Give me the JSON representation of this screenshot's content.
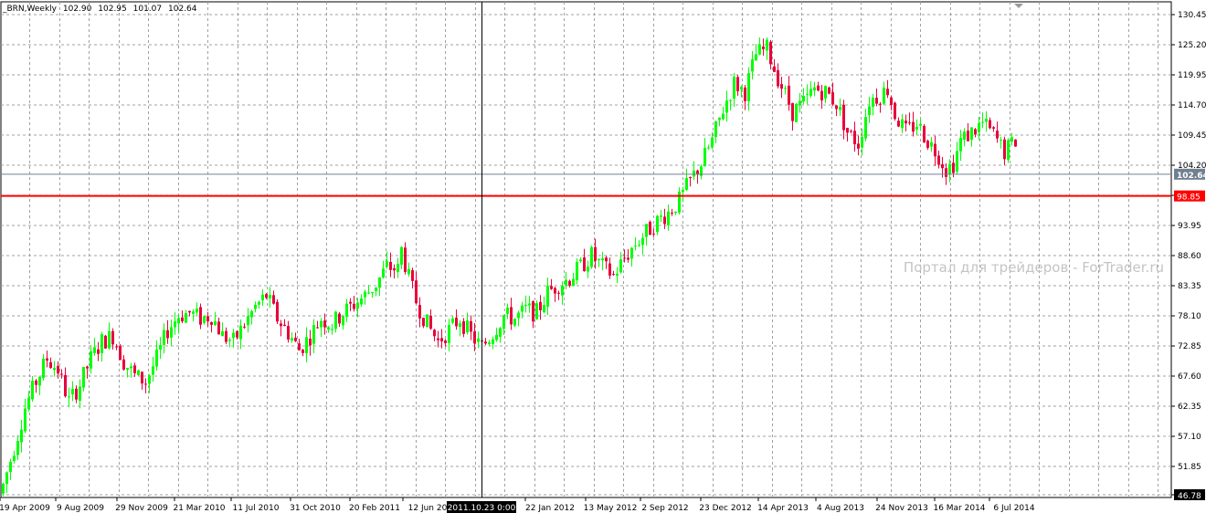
{
  "header": {
    "symbol": "_BRN,Weekly",
    "open": "102.90",
    "high": "102.95",
    "low": "101.07",
    "close": "102.64"
  },
  "watermark": "Портал для трейдеров - ForTrader.ru",
  "colors": {
    "bull": "#00ff00",
    "bear": "#e8003a",
    "grid": "#a0a0a0",
    "level_line": "#ff0000",
    "current_line": "#708090"
  },
  "chart_data": {
    "type": "candlestick",
    "timeframe": "Weekly",
    "symbol": "_BRN",
    "y_ticks": [
      "130.45",
      "125.20",
      "119.95",
      "114.70",
      "109.45",
      "104.20",
      "98.95",
      "93.95",
      "88.60",
      "83.35",
      "78.10",
      "72.85",
      "67.60",
      "62.35",
      "57.10",
      "51.85",
      "46.78"
    ],
    "ylim": [
      46.78,
      131.5
    ],
    "x_ticks": [
      "19 Apr 2009",
      "9 Aug 2009",
      "29 Nov 2009",
      "21 Mar 2010",
      "11 Jul 2010",
      "31 Oct 2010",
      "20 Feb 2011",
      "12 Jun 20",
      "22 Jan 2012",
      "13 May 2012",
      "2 Sep 2012",
      "23 Dec 2012",
      "14 Apr 2013",
      "4 Aug 2013",
      "24 Nov 2013",
      "16 Mar 2014",
      "6 Jul 2014"
    ],
    "crosshair_time": "2011.10.23 0:00",
    "current_price": "102.64",
    "horizontal_level": "98.85",
    "candle_count": 279,
    "close_path": [
      [
        0,
        48.5
      ],
      [
        3,
        55.0
      ],
      [
        6,
        62.0
      ],
      [
        9,
        66.5
      ],
      [
        12,
        70.5
      ],
      [
        15,
        68.5
      ],
      [
        18,
        63.0
      ],
      [
        21,
        66.0
      ],
      [
        24,
        70.5
      ],
      [
        27,
        73.5
      ],
      [
        30,
        74.5
      ],
      [
        33,
        70.0
      ],
      [
        36,
        67.5
      ],
      [
        39,
        66.5
      ],
      [
        42,
        70.5
      ],
      [
        45,
        75.5
      ],
      [
        48,
        78.0
      ],
      [
        51,
        78.5
      ],
      [
        54,
        77.5
      ],
      [
        57,
        78.0
      ],
      [
        60,
        74.5
      ],
      [
        63,
        73.5
      ],
      [
        66,
        76.5
      ],
      [
        69,
        79.5
      ],
      [
        72,
        81.5
      ],
      [
        75,
        77.5
      ],
      [
        78,
        75.0
      ],
      [
        81,
        72.0
      ],
      [
        84,
        74.5
      ],
      [
        87,
        77.5
      ],
      [
        90,
        76.5
      ],
      [
        93,
        78.5
      ],
      [
        96,
        80.0
      ],
      [
        99,
        81.5
      ],
      [
        102,
        83.5
      ],
      [
        105,
        86.5
      ],
      [
        108,
        86.0
      ],
      [
        109,
        89.5
      ],
      [
        111,
        84.5
      ],
      [
        113,
        80.5
      ],
      [
        116,
        76.5
      ],
      [
        119,
        73.5
      ],
      [
        122,
        75.5
      ],
      [
        125,
        77.5
      ],
      [
        128,
        74.5
      ],
      [
        131,
        72.5
      ],
      [
        134,
        75.0
      ],
      [
        137,
        78.0
      ],
      [
        140,
        77.5
      ],
      [
        143,
        79.0
      ],
      [
        146,
        78.5
      ],
      [
        149,
        82.0
      ],
      [
        152,
        83.5
      ],
      [
        155,
        84.5
      ],
      [
        158,
        86.5
      ],
      [
        161,
        88.5
      ],
      [
        164,
        86.5
      ],
      [
        167,
        85.0
      ],
      [
        170,
        88.0
      ],
      [
        173,
        90.5
      ],
      [
        176,
        92.5
      ],
      [
        179,
        94.5
      ],
      [
        182,
        96.0
      ],
      [
        185,
        98.0
      ],
      [
        188,
        101.5
      ],
      [
        191,
        104.5
      ],
      [
        194,
        108.5
      ],
      [
        197,
        114.0
      ],
      [
        200,
        118.5
      ],
      [
        203,
        117.0
      ],
      [
        206,
        123.5
      ],
      [
        209,
        124.5
      ],
      [
        211,
        121.0
      ],
      [
        213,
        118.0
      ],
      [
        216,
        113.5
      ],
      [
        219,
        115.0
      ],
      [
        222,
        117.5
      ],
      [
        225,
        117.0
      ],
      [
        228,
        115.0
      ],
      [
        231,
        110.0
      ],
      [
        234,
        108.0
      ],
      [
        237,
        115.5
      ],
      [
        240,
        116.5
      ],
      [
        242,
        117.5
      ],
      [
        244,
        113.0
      ],
      [
        247,
        110.0
      ],
      [
        250,
        111.5
      ],
      [
        253,
        108.5
      ],
      [
        256,
        106.0
      ],
      [
        258,
        103.5
      ],
      [
        260,
        104.5
      ],
      [
        262,
        108.5
      ],
      [
        265,
        110.0
      ],
      [
        268,
        111.5
      ],
      [
        271,
        109.5
      ],
      [
        274,
        106.5
      ],
      [
        277,
        108.5
      ]
    ],
    "close_path_axis": "candle index (0 = 19 Apr 2009) vs price; a smooth walk through this path generates the displayed candles"
  }
}
